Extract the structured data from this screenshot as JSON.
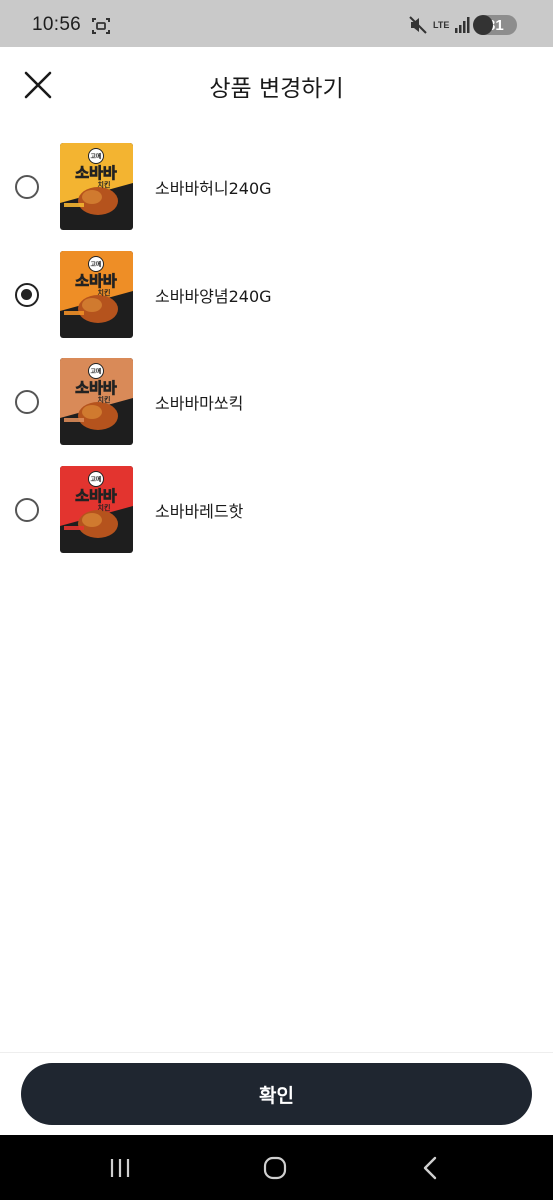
{
  "status_bar": {
    "time": "10:56",
    "network": "LTE",
    "battery": "31",
    "icons": [
      "screenshot-icon",
      "mute-icon",
      "signal-icon",
      "battery-icon"
    ]
  },
  "header": {
    "title": "상품 변경하기",
    "close_icon": "close-icon"
  },
  "products": [
    {
      "name": "소바바허니240G",
      "selected": false,
      "package_color": "#f3b431",
      "brand": "고메",
      "product_line": "소바바",
      "sub": "치킨"
    },
    {
      "name": "소바바양념240G",
      "selected": true,
      "package_color": "#ee8e26",
      "brand": "고메",
      "product_line": "소바바",
      "sub": "치킨"
    },
    {
      "name": "소바바마쏘킥",
      "selected": false,
      "package_color": "#d98a58",
      "brand": "고메",
      "product_line": "소바바",
      "sub": "치킨"
    },
    {
      "name": "소바바레드핫",
      "selected": false,
      "package_color": "#e3342f",
      "brand": "고메",
      "product_line": "소바바",
      "sub": "치킨"
    }
  ],
  "confirm_button": {
    "label": "확인"
  },
  "nav_bar": {
    "icons": [
      "recent-apps-icon",
      "home-icon",
      "back-icon"
    ]
  }
}
